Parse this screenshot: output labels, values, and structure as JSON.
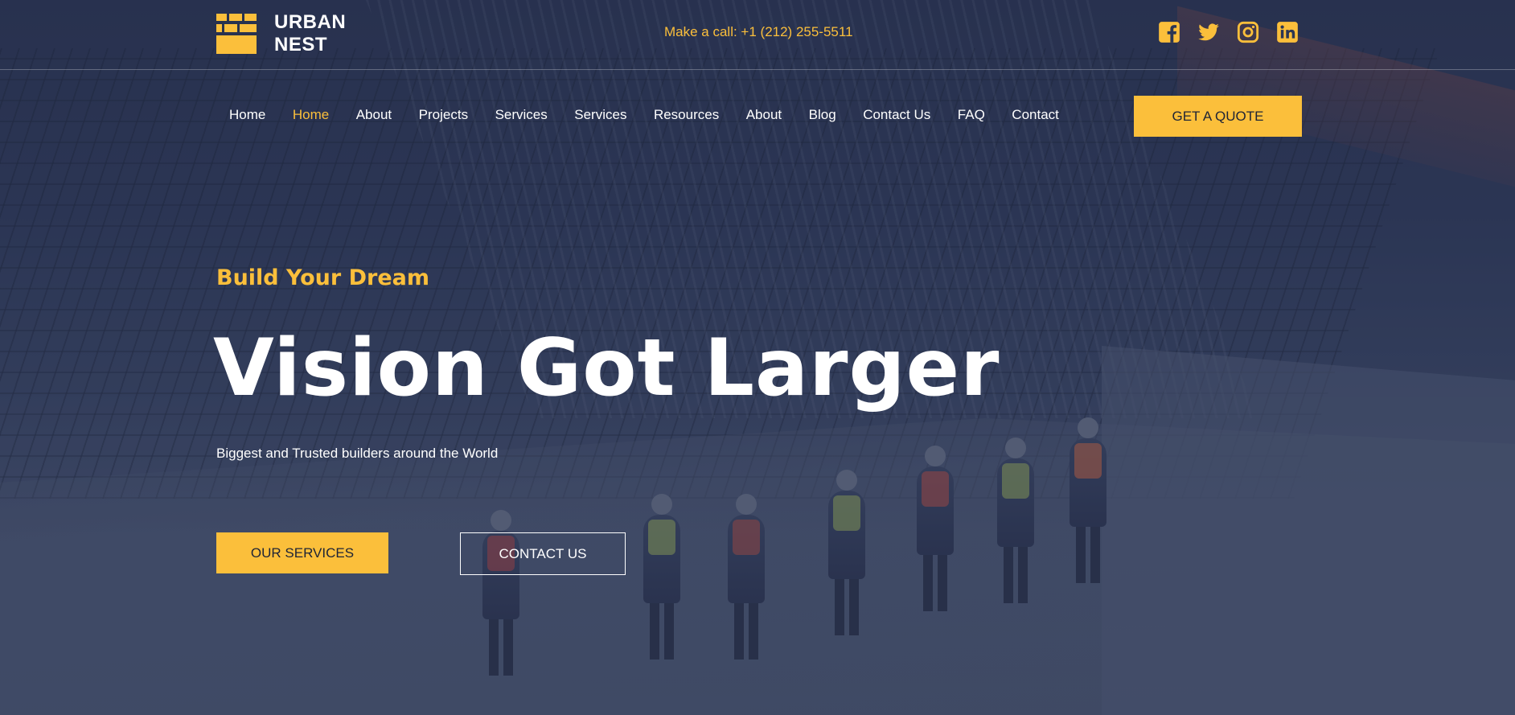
{
  "brand": {
    "name_line1": "URBAN",
    "name_line2": "NEST",
    "accent_color": "#fbbf3b"
  },
  "header": {
    "call_text": "Make a call: +1 (212) 255-5511",
    "socials": [
      "facebook-icon",
      "twitter-icon",
      "instagram-icon",
      "linkedin-icon"
    ]
  },
  "nav": {
    "items": [
      {
        "label": "Home"
      },
      {
        "label": "Home",
        "active": true
      },
      {
        "label": "About"
      },
      {
        "label": "Projects"
      },
      {
        "label": "Services"
      },
      {
        "label": "Services"
      },
      {
        "label": "Resources"
      },
      {
        "label": "About"
      },
      {
        "label": "Blog"
      },
      {
        "label": "Contact Us"
      },
      {
        "label": "FAQ"
      },
      {
        "label": "Contact"
      }
    ],
    "cta_label": "GET A QUOTE"
  },
  "hero": {
    "eyebrow": "Build Your Dream",
    "title": "Vision Got Larger",
    "subtitle": "Biggest and Trusted builders around the World",
    "primary_button": "OUR SERVICES",
    "secondary_button": "CONTACT US"
  }
}
